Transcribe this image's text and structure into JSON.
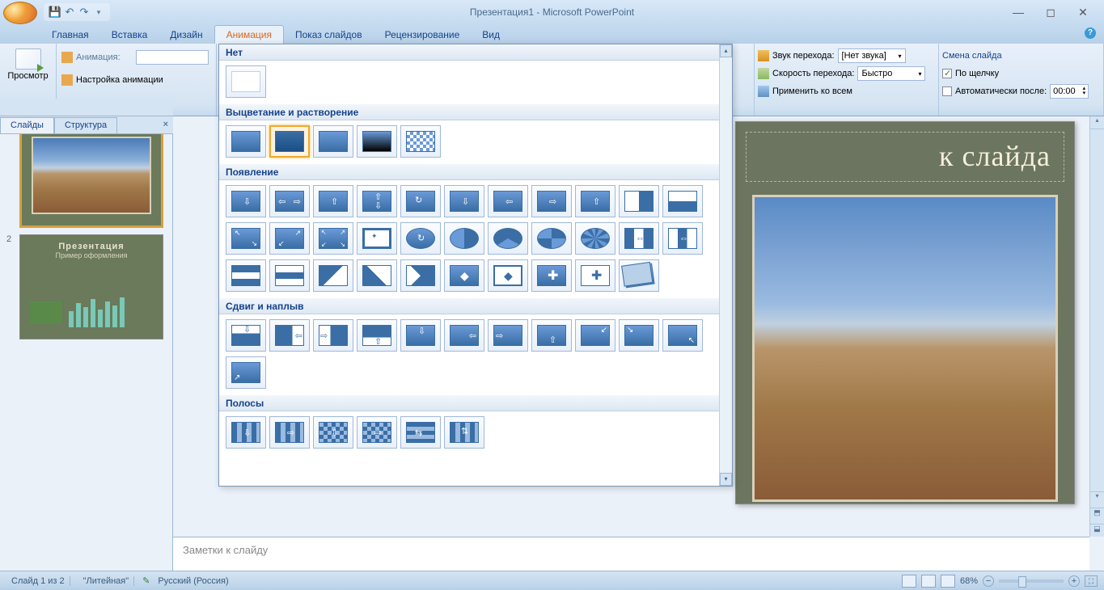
{
  "title": "Презентация1 - Microsoft PowerPoint",
  "tabs": [
    "Главная",
    "Вставка",
    "Дизайн",
    "Анимация",
    "Показ слайдов",
    "Рецензирование",
    "Вид"
  ],
  "active_tab": 3,
  "preview": {
    "label": "Просмотр",
    "group": "Просмотр"
  },
  "anim_group": {
    "label": "Анимация",
    "anim_label": "Анимация:",
    "custom": "Настройка анимации"
  },
  "gallery": {
    "none": "Нет",
    "fade": "Выцветание и растворение",
    "appear": "Появление",
    "push": "Сдвиг и наплыв",
    "stripes": "Полосы"
  },
  "trans": {
    "sound_label_icon": "🔊",
    "sound_label": "Звук перехода:",
    "sound_value": "[Нет звука]",
    "speed_label": "Скорость перехода:",
    "speed_value": "Быстро",
    "apply_all": "Применить ко всем"
  },
  "advance": {
    "group": "Смена слайда",
    "on_click": "По щелчку",
    "auto_after": "Автоматически после:",
    "time": "00:00"
  },
  "slides_pane": {
    "tab_slides": "Слайды",
    "tab_outline": "Структура"
  },
  "slide2": {
    "title": "Презентация",
    "sub": "Пример оформления"
  },
  "slide_canvas": {
    "title": "к слайда"
  },
  "notes": "Заметки к слайду",
  "status": {
    "slide": "Слайд 1 из 2",
    "theme": "\"Литейная\"",
    "lang": "Русский (Россия)",
    "zoom": "68%"
  }
}
